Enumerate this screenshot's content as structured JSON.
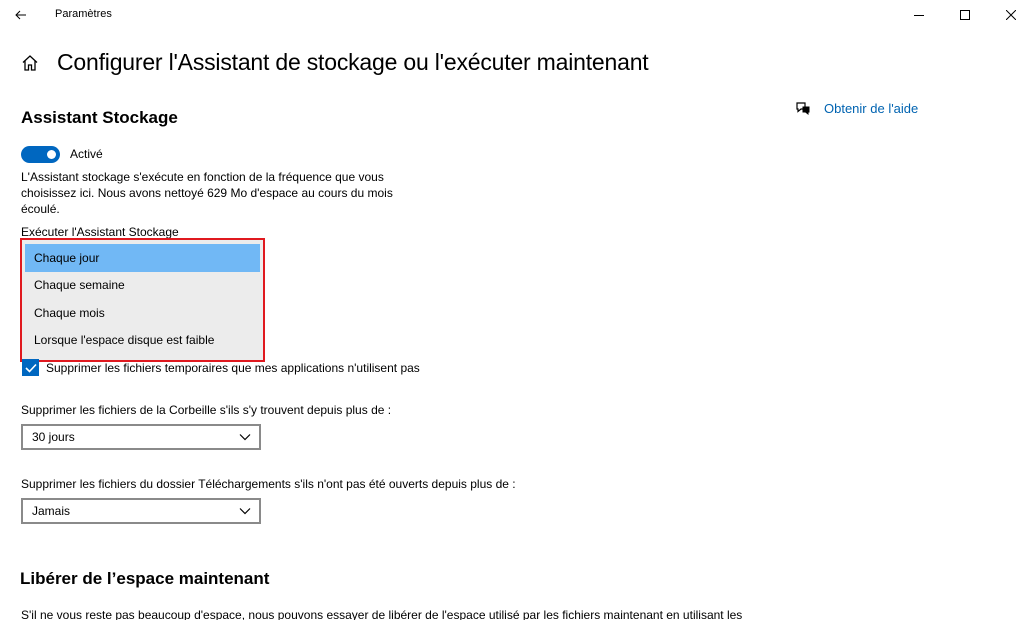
{
  "window": {
    "title": "Paramètres",
    "back_icon": "back-arrow-icon",
    "controls": [
      "minimize-icon",
      "maximize-icon",
      "close-icon"
    ]
  },
  "page": {
    "title": "Configurer l'Assistant de stockage ou l'exécuter maintenant",
    "home_icon": "home-icon"
  },
  "help": {
    "label": "Obtenir de l'aide",
    "icon": "help-chat-icon"
  },
  "storage_sense": {
    "heading": "Assistant Stockage",
    "toggle_label": "Activé",
    "toggle_on": true,
    "description": "L'Assistant stockage s'exécute en fonction de la fréquence que vous choisissez ici. Nous avons nettoyé 629 Mo d'espace au cours du mois écoulé.",
    "run_label": "Exécuter l'Assistant Stockage",
    "run_options": [
      "Chaque jour",
      "Chaque semaine",
      "Chaque mois",
      "Lorsque l'espace disque est faible"
    ],
    "run_selected": "Chaque jour"
  },
  "temp_files": {
    "label": "Supprimer les fichiers temporaires que mes applications n'utilisent pas",
    "checked": true
  },
  "recycle_bin": {
    "label": "Supprimer les fichiers de la Corbeille s'ils s'y trouvent depuis plus de :",
    "value": "30 jours"
  },
  "downloads": {
    "label": "Supprimer les fichiers du dossier Téléchargements s'ils n'ont pas été ouverts depuis plus de :",
    "value": "Jamais"
  },
  "free_space": {
    "heading": "Libérer de l’espace maintenant",
    "description": "S'il ne vous reste pas beaucoup d'espace, nous pouvons essayer de libérer de l'espace utilisé par les fichiers maintenant en utilisant les"
  },
  "colors": {
    "accent": "#0067c0",
    "link": "#0063b1",
    "highlight_border": "#e0191f",
    "selected_option": "#71b8f5"
  }
}
